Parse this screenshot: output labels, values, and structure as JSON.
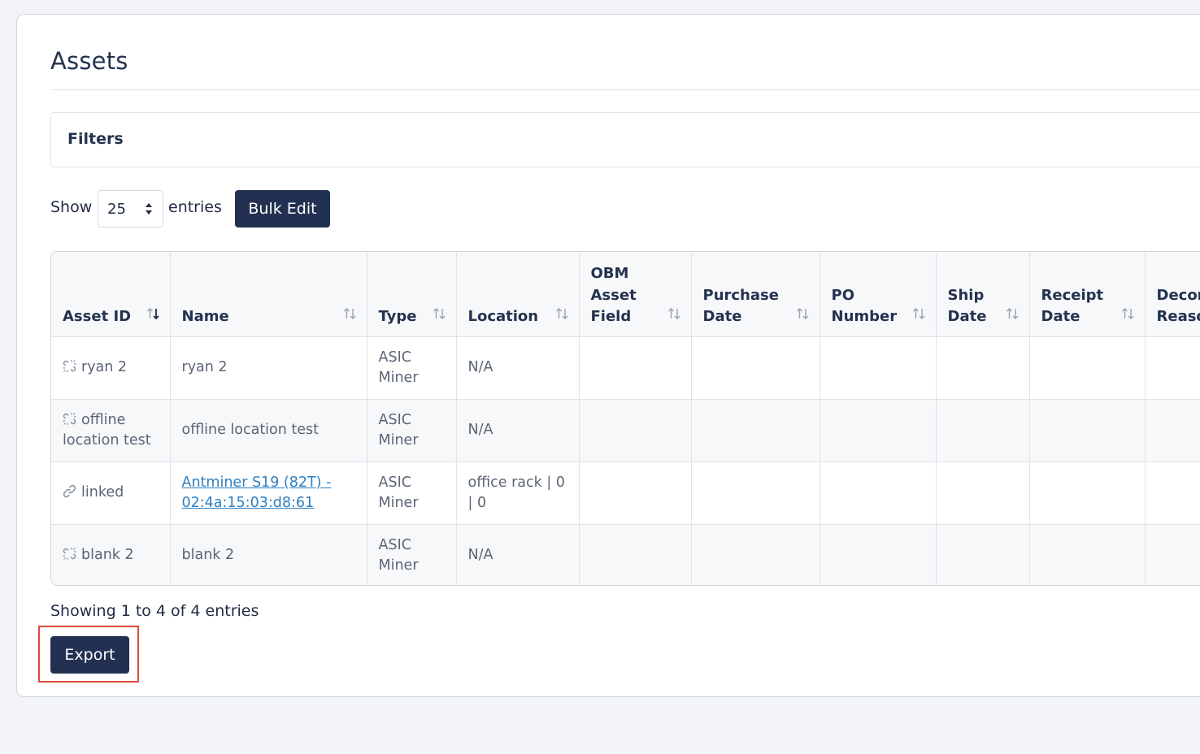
{
  "page": {
    "title": "Assets",
    "filters_label": "Filters"
  },
  "length_menu": {
    "show_label": "Show",
    "selected_value": "25",
    "entries_label": "entries"
  },
  "buttons": {
    "bulk_edit": "Bulk Edit",
    "export": "Export"
  },
  "table": {
    "columns": [
      {
        "label": "Asset ID",
        "sort": "descending"
      },
      {
        "label": "Name",
        "sort": "none"
      },
      {
        "label": "Type",
        "sort": "none"
      },
      {
        "label": "Location",
        "sort": "none"
      },
      {
        "label": "OBM Asset Field",
        "sort": "none"
      },
      {
        "label": "Purchase Date",
        "sort": "none"
      },
      {
        "label": "PO Number",
        "sort": "none"
      },
      {
        "label": "Ship Date",
        "sort": "none"
      },
      {
        "label": "Receipt Date",
        "sort": "none"
      },
      {
        "label": "Decom Reason",
        "sort": "none"
      }
    ],
    "rows": [
      {
        "asset_id": "ryan 2",
        "link_icon": "unlink-icon",
        "name": "ryan 2",
        "name_is_link": false,
        "type": "ASIC Miner",
        "location": "N/A"
      },
      {
        "asset_id": "offline location test",
        "link_icon": "unlink-icon",
        "name": "offline location test",
        "name_is_link": false,
        "type": "ASIC Miner",
        "location": "N/A"
      },
      {
        "asset_id": "linked",
        "link_icon": "link-icon",
        "name": "Antminer S19 (82T) - 02:4a:15:03:d8:61",
        "name_is_link": true,
        "type": "ASIC Miner",
        "location": "office rack | 0 | 0"
      },
      {
        "asset_id": "blank 2",
        "link_icon": "unlink-icon",
        "name": "blank 2",
        "name_is_link": false,
        "type": "ASIC Miner",
        "location": "N/A"
      }
    ]
  },
  "info_text": "Showing 1 to 4 of 4 entries",
  "colors": {
    "primary_button": "#223152",
    "link": "#2f7fc1",
    "highlight_border": "#e0463a"
  }
}
